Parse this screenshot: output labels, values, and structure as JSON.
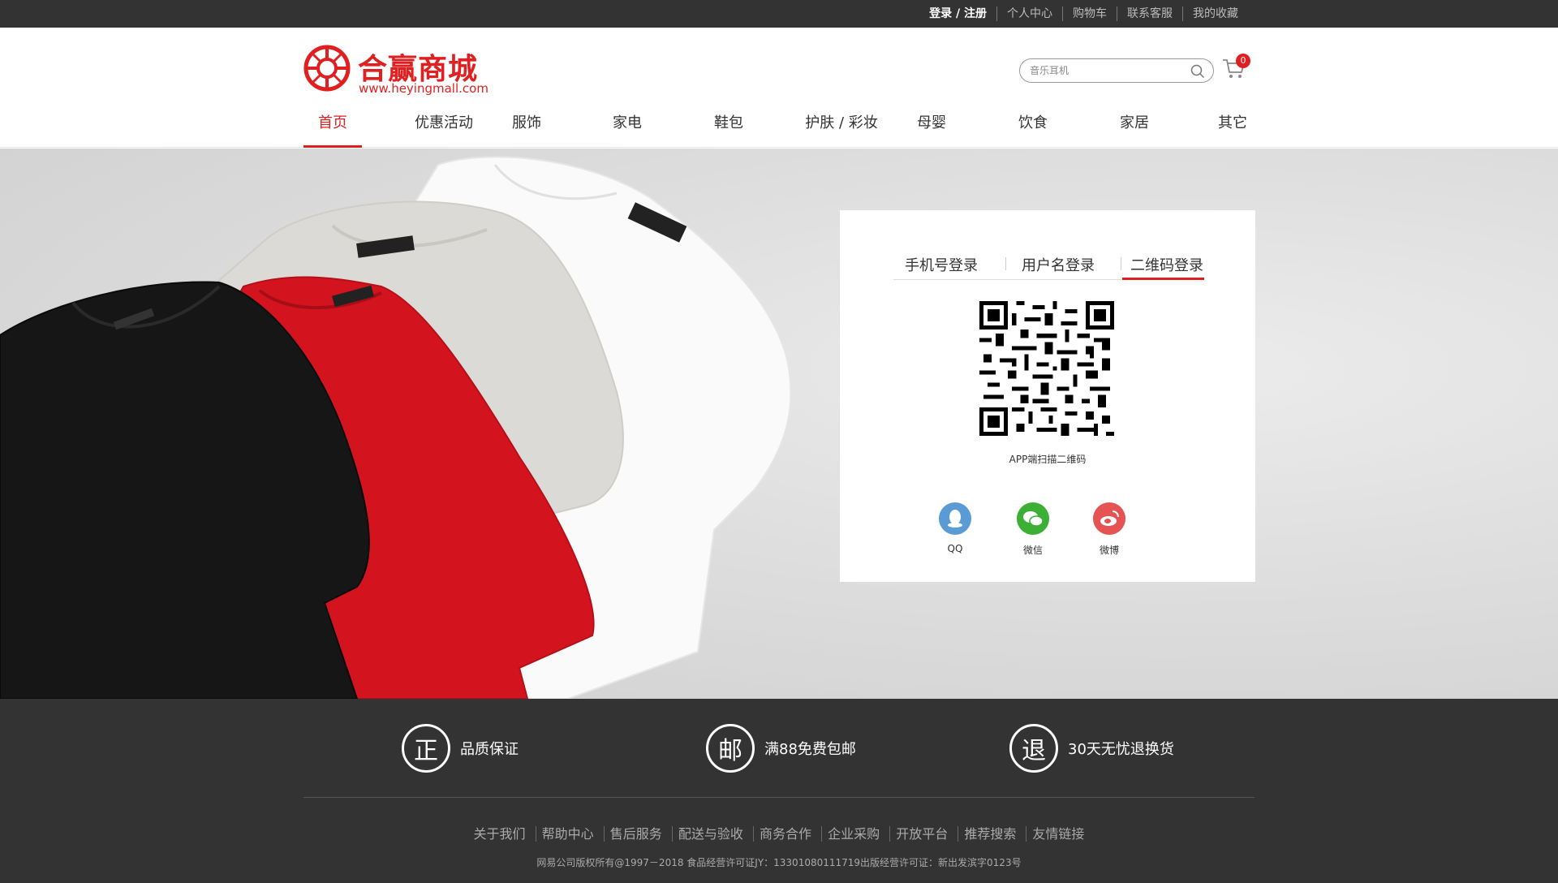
{
  "topbar": {
    "links": [
      "登录 / 注册",
      "个人中心",
      "购物车",
      "联系客服",
      "我的收藏"
    ]
  },
  "header": {
    "logo_name": "合赢商城",
    "logo_url": "www.heyingmall.com",
    "search_placeholder": "音乐耳机",
    "cart_count": "0",
    "brand_color": "#e02020",
    "nav": [
      "首页",
      "优惠活动",
      "服饰",
      "家电",
      "鞋包",
      "护肤 / 彩妆",
      "母婴",
      "饮食",
      "家居",
      "其它"
    ],
    "nav_active": "首页"
  },
  "login": {
    "tabs": [
      "手机号登录",
      "用户名登录",
      "二维码登录"
    ],
    "active_tab": "二维码登录",
    "qr_caption": "APP端扫描二维码",
    "social": [
      {
        "label": "QQ",
        "icon": "qq-icon",
        "color": "#5b9bd5"
      },
      {
        "label": "微信",
        "icon": "wechat-icon",
        "color": "#3cb034"
      },
      {
        "label": "微博",
        "icon": "weibo-icon",
        "color": "#e55353"
      }
    ]
  },
  "footer": {
    "promises": [
      {
        "glyph": "正",
        "text": "品质保证"
      },
      {
        "glyph": "邮",
        "text": "满88免费包邮"
      },
      {
        "glyph": "退",
        "text": "30天无忧退换货"
      }
    ],
    "links": [
      "关于我们",
      "帮助中心",
      "售后服务",
      "配送与验收",
      "商务合作",
      "企业采购",
      "开放平台",
      "推荐搜索",
      "友情链接"
    ],
    "copyright": "网易公司版权所有@1997－2018   食品经营许可证JY：13301080111719出版经营许可证：新出发滨字0123号"
  }
}
